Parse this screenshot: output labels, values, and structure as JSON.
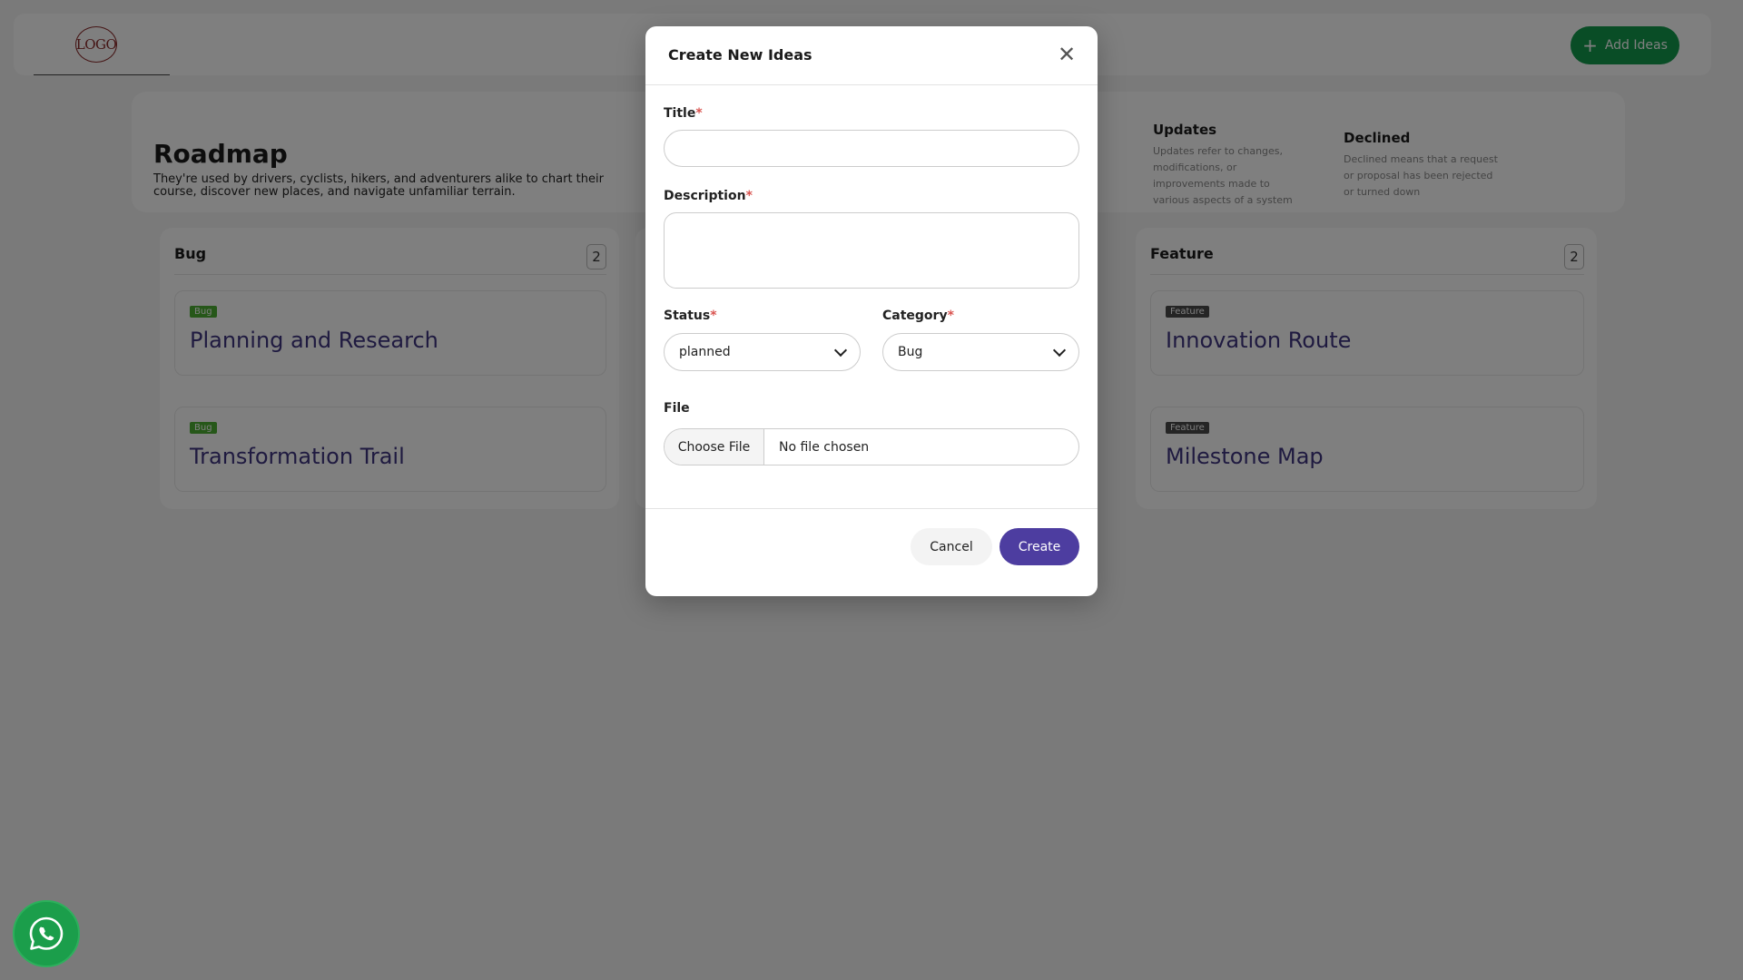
{
  "header": {
    "logo_text": "LOGO",
    "add_ideas_label": "Add Ideas"
  },
  "roadmap": {
    "title": "Roadmap",
    "description": "They're used by drivers, cyclists, hikers, and adventurers alike to chart their course, discover new places, and navigate unfamiliar terrain.",
    "legend": [
      {
        "title": "Updates",
        "text": "Updates refer to changes, modifications, or improvements made to various aspects of a system"
      },
      {
        "title": "Declined",
        "text": "Declined means that a request or proposal has been rejected or turned down"
      }
    ]
  },
  "columns": [
    {
      "title": "Bug",
      "count": "2",
      "cards": [
        {
          "tag": "Bug",
          "title": "Planning and Research"
        },
        {
          "tag": "Bug",
          "title": "Transformation Trail"
        }
      ]
    },
    {
      "title": "Feature",
      "count": "2",
      "cards": [
        {
          "tag": "Feature",
          "title": "Innovation Route"
        },
        {
          "tag": "Feature",
          "title": "Milestone Map"
        }
      ]
    }
  ],
  "modal": {
    "title": "Create New Ideas",
    "required_mark": "*",
    "title_label": "Title",
    "title_value": "",
    "description_label": "Description",
    "description_value": "",
    "status_label": "Status",
    "status_value": "planned",
    "category_label": "Category",
    "category_value": "Bug",
    "file_label": "File",
    "choose_file_label": "Choose File",
    "no_file_text": "No file chosen",
    "cancel_label": "Cancel",
    "create_label": "Create"
  },
  "colors": {
    "add_ideas": "#129a4c",
    "create_button": "#4d3da0",
    "card_title": "#3e3580",
    "bug_tag": "#4caf32",
    "feature_tag": "#4a4a4a",
    "whatsapp": "#1b9e4b"
  },
  "icons": {
    "close": "close-icon",
    "plus": "plus-icon",
    "chevron": "chevron-down-icon",
    "whatsapp": "whatsapp-icon"
  }
}
